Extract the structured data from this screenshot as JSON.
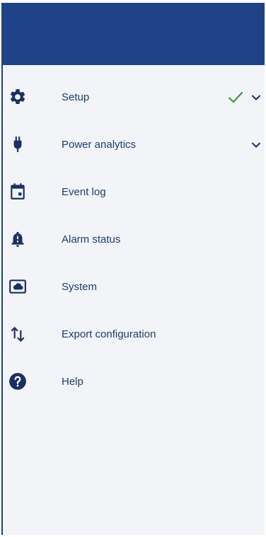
{
  "menu": {
    "items": [
      {
        "label": "Setup",
        "icon": "gear-icon",
        "status_icon": "check-icon",
        "expand_icon": "chevron-down-icon"
      },
      {
        "label": "Power analytics",
        "icon": "plug-icon",
        "expand_icon": "chevron-down-icon"
      },
      {
        "label": "Event log",
        "icon": "calendar-icon"
      },
      {
        "label": "Alarm status",
        "icon": "bell-alert-icon"
      },
      {
        "label": "System",
        "icon": "cloud-icon"
      },
      {
        "label": "Export configuration",
        "icon": "sort-arrows-icon"
      },
      {
        "label": "Help",
        "icon": "help-icon"
      }
    ]
  },
  "colors": {
    "header": "#1f4287",
    "icon": "#1a2f63",
    "text": "#1f3a6e",
    "check": "#3c9a3c",
    "panel_bg": "#f2f4f8"
  }
}
